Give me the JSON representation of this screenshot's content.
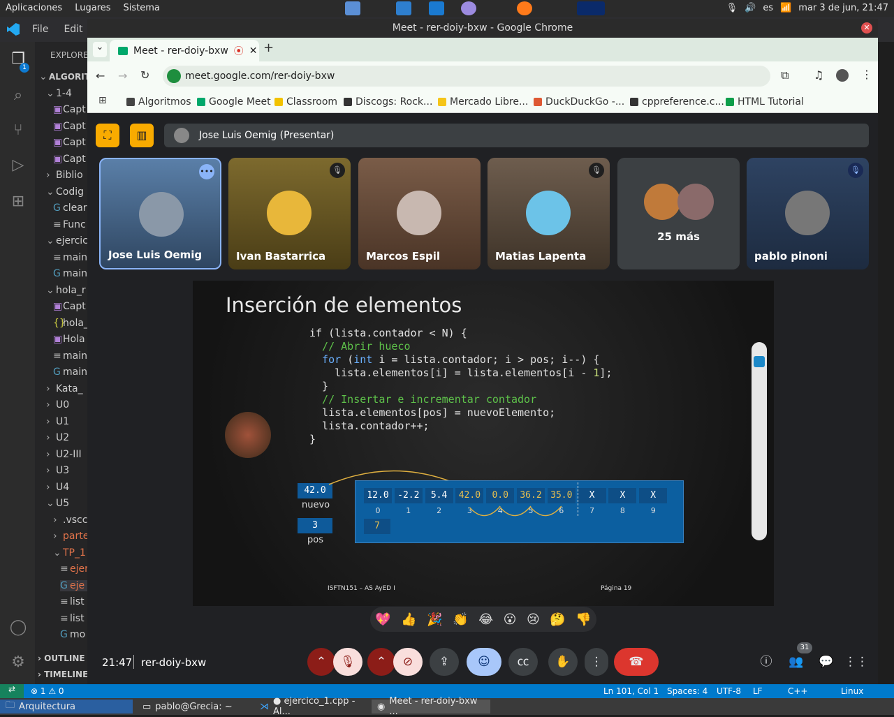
{
  "top_panel": {
    "menu": [
      "Aplicaciones",
      "Lugares",
      "Sistema"
    ],
    "lang": "es",
    "clock": "mar  3 de jun, 21:47"
  },
  "vscode": {
    "menu": [
      "File",
      "Edit"
    ],
    "explorer_label": "EXPLORE",
    "tree": [
      {
        "t": "ALGORIT",
        "c": "v",
        "ind": 0,
        "b": true
      },
      {
        "t": "1-4",
        "c": "v",
        "ind": 1
      },
      {
        "t": "Capt",
        "c": "img",
        "ind": 2
      },
      {
        "t": "Capt",
        "c": "img",
        "ind": 2
      },
      {
        "t": "Capt",
        "c": "img",
        "ind": 2
      },
      {
        "t": "Capt",
        "c": "img",
        "ind": 2
      },
      {
        "t": "Biblio",
        "c": ">",
        "ind": 1
      },
      {
        "t": "Codig",
        "c": "v",
        "ind": 1
      },
      {
        "t": "clear",
        "c": "G",
        "ind": 2
      },
      {
        "t": "Func",
        "c": "≡",
        "ind": 2
      },
      {
        "t": "ejercic",
        "c": "v",
        "ind": 1
      },
      {
        "t": "main",
        "c": "≡",
        "ind": 2
      },
      {
        "t": "main",
        "c": "G",
        "ind": 2
      },
      {
        "t": "hola_r",
        "c": "v",
        "ind": 1
      },
      {
        "t": "Capt",
        "c": "img",
        "ind": 2
      },
      {
        "t": "hola_",
        "c": "{}",
        "ind": 2
      },
      {
        "t": "Hola",
        "c": "img",
        "ind": 2
      },
      {
        "t": "main",
        "c": "≡",
        "ind": 2
      },
      {
        "t": "main",
        "c": "G",
        "ind": 2
      },
      {
        "t": "Kata_",
        "c": ">",
        "ind": 1
      },
      {
        "t": "U0",
        "c": ">",
        "ind": 1
      },
      {
        "t": "U1",
        "c": ">",
        "ind": 1
      },
      {
        "t": "U2",
        "c": ">",
        "ind": 1
      },
      {
        "t": "U2-III",
        "c": ">",
        "ind": 1
      },
      {
        "t": "U3",
        "c": ">",
        "ind": 1
      },
      {
        "t": "U4",
        "c": ">",
        "ind": 1
      },
      {
        "t": "U5",
        "c": "v",
        "ind": 1
      },
      {
        "t": ".vscc",
        "c": ">",
        "ind": 2
      },
      {
        "t": "parte",
        "c": ">",
        "ind": 2
      },
      {
        "t": "TP_1",
        "c": "v",
        "ind": 2
      },
      {
        "t": "ejer",
        "c": "≡",
        "ind": 3
      },
      {
        "t": "eje",
        "c": "G",
        "ind": 3
      },
      {
        "t": "list",
        "c": "≡",
        "ind": 3
      },
      {
        "t": "list",
        "c": "≡",
        "ind": 3
      },
      {
        "t": "mo",
        "c": "G",
        "ind": 3
      }
    ],
    "outline": "OUTLINE",
    "timeline": "TIMELINE",
    "status": {
      "errors": "1",
      "warnings": "0",
      "pos": "Ln 101, Col 1",
      "spaces": "Spaces: 4",
      "enc": "UTF-8",
      "eol": "LF",
      "lang": "C++",
      "os": "Linux"
    },
    "badge": "1"
  },
  "taskbar": {
    "items": [
      "Arquitectura",
      "pablo@Grecia: ~",
      "● ejercico_1.cpp - Al...",
      "Meet - rer-doiy-bxw ..."
    ]
  },
  "chrome": {
    "window_title": "Meet - rer-doiy-bxw - Google Chrome",
    "tab_title": "Meet - rer-doiy-bxw",
    "url": "meet.google.com/rer-doiy-bxw",
    "bookmarks": [
      "Algoritmos",
      "Google Meet",
      "Classroom",
      "Discogs: Rock...",
      "Mercado Libre...",
      "DuckDuckGo -...",
      "cppreference.c...",
      "HTML Tutorial"
    ]
  },
  "meet": {
    "presenter": "Jose Luis Oemig (Presentar)",
    "tiles": [
      {
        "name": "Jose Luis Oemig"
      },
      {
        "name": "Ivan Bastarrica"
      },
      {
        "name": "Marcos Espil"
      },
      {
        "name": "Matias Lapenta"
      },
      {
        "name": "25 más"
      },
      {
        "name": "pablo pinoni"
      }
    ],
    "time": "21:47",
    "code": "rer-doiy-bxw",
    "people_count": "31",
    "reactions": [
      "💖",
      "👍",
      "🎉",
      "👏",
      "😂",
      "😮",
      "😢",
      "🤔",
      "👎"
    ]
  },
  "slide": {
    "title": "Inserción de elementos",
    "code": [
      [
        {
          "k": "",
          "t": "if (lista.contador < N) {"
        }
      ],
      [
        {
          "k": "cm",
          "t": "  // Abrir hueco"
        }
      ],
      [
        {
          "k": "kw",
          "t": "  for "
        },
        {
          "k": "",
          "t": "("
        },
        {
          "k": "kw",
          "t": "int"
        },
        {
          "k": "",
          "t": " i = lista.contador; i > pos; i--) {"
        }
      ],
      [
        {
          "k": "",
          "t": "    lista.elementos[i] = lista.elementos[i - "
        },
        {
          "k": "nu",
          "t": "1"
        },
        {
          "k": "",
          "t": "];"
        }
      ],
      [
        {
          "k": "",
          "t": "  }"
        }
      ],
      [
        {
          "k": "cm",
          "t": "  // Insertar e incrementar contador"
        }
      ],
      [
        {
          "k": "",
          "t": "  lista.elementos[pos] = nuevoElemento;"
        }
      ],
      [
        {
          "k": "",
          "t": "  lista.contador++;"
        }
      ],
      [
        {
          "k": "",
          "t": "}"
        }
      ]
    ],
    "nuevo_value": "42.0",
    "nuevo_label": "nuevo",
    "pos_value": "3",
    "pos_label": "pos",
    "cells": [
      "12.0",
      "-2.2",
      "5.4",
      "42.0",
      "0.0",
      "36.2",
      "35.0",
      "X",
      "X",
      "X"
    ],
    "indices": [
      "0",
      "1",
      "2",
      "3",
      "4",
      "5",
      "6",
      "7",
      "8",
      "9"
    ],
    "contador": "7",
    "footer_left": "ISFTN151 – AS AyED I",
    "footer_right": "Página 19"
  }
}
